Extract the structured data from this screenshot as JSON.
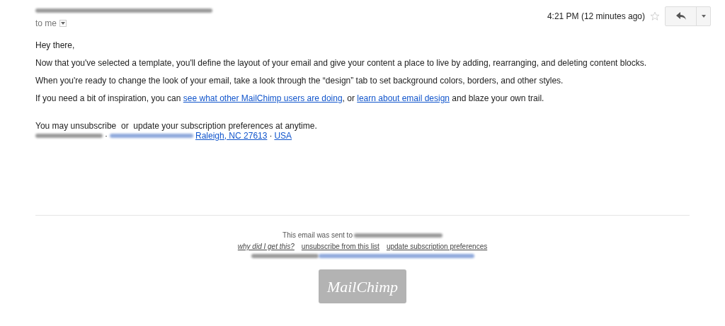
{
  "header": {
    "recipient": "to me",
    "time": "4:21 PM (12 minutes ago)",
    "starred": false
  },
  "body": {
    "greeting": "Hey there,",
    "paragraphs": [
      {
        "parts": [
          {
            "text": "Now that you've selected a template, you'll define the layout of your email and give your content a place to live by adding, rearranging, and deleting content blocks."
          }
        ]
      },
      {
        "parts": [
          {
            "text": "When you're ready to change the look of your email, take a look through the “design” tab to set background colors, borders, and other styles."
          }
        ]
      },
      {
        "parts": [
          {
            "text": "If you need a bit of inspiration, you can "
          },
          {
            "text": "see what other MailChimp users are doing",
            "link": true
          },
          {
            "text": ", or "
          },
          {
            "text": "learn about email design",
            "link": true
          },
          {
            "text": " and blaze your own trail."
          }
        ]
      }
    ],
    "unsubscribe_note": "You may unsubscribe  or  update your subscription preferences at anytime.",
    "address": [
      {
        "text": "·"
      },
      {
        "text": "Raleigh, NC 27613",
        "link": true
      },
      {
        "text": "·"
      },
      {
        "text": "USA",
        "link": true
      }
    ]
  },
  "footer": {
    "sent_to": "This email was sent to",
    "links": [
      {
        "text": "why did I get this?",
        "italic": true
      },
      {
        "text": "unsubscribe from this list",
        "italic": false
      },
      {
        "text": "update subscription preferences",
        "italic": false
      }
    ],
    "logo": "MailChimp"
  }
}
